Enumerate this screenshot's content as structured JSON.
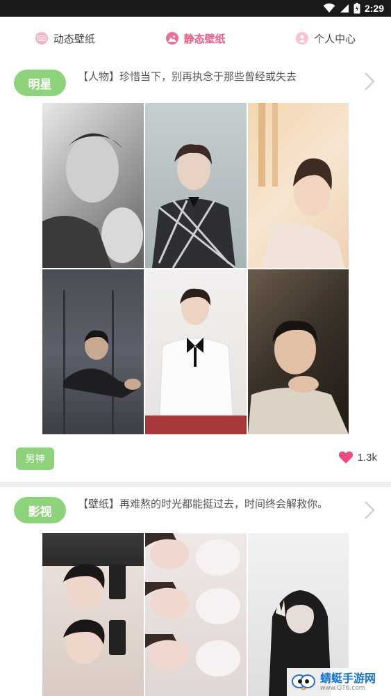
{
  "status_bar": {
    "time": "2:29"
  },
  "tabs": [
    {
      "label": "动态壁纸",
      "active": false
    },
    {
      "label": "静态壁纸",
      "active": true
    },
    {
      "label": "个人中心",
      "active": false
    }
  ],
  "cards": [
    {
      "category": "明星",
      "description": "【人物】珍惜当下，别再执念于那些曾经或失去",
      "tag": "男神",
      "likes": "1.3k"
    },
    {
      "category": "影视",
      "description": "【壁纸】再难熬的时光都能挺过去，时间终会解救你。"
    }
  ],
  "watermark": {
    "main": "蜻蜓手游网",
    "sub": "www.QT6.com"
  },
  "colors": {
    "accent_pink": "#e95f86",
    "pill_green": "#8ed37c",
    "heart": "#ec4d7a"
  }
}
